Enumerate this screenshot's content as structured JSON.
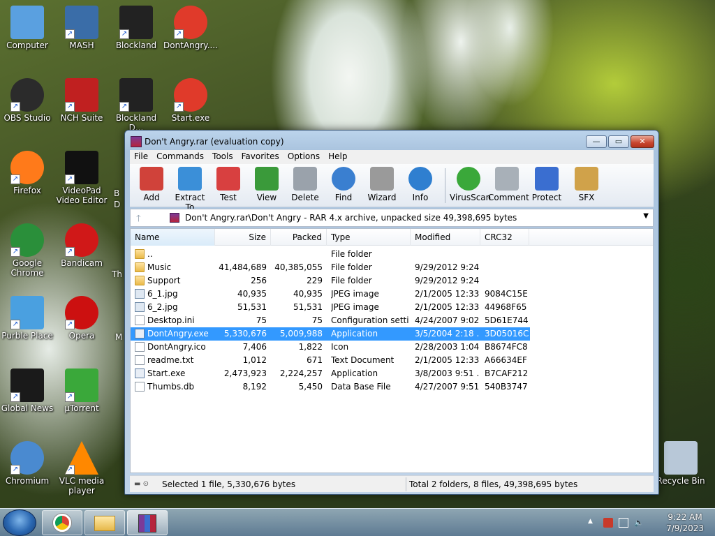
{
  "desktop": {
    "icons": [
      {
        "id": "computer",
        "label": "Computer",
        "color": "#5aa0e0"
      },
      {
        "id": "mash",
        "label": "MASH",
        "color": "#3a6da8"
      },
      {
        "id": "blockland",
        "label": "Blockland",
        "color": "#222222"
      },
      {
        "id": "dontangry",
        "label": "DontAngry....",
        "color": "#e03a2a"
      },
      {
        "id": "obs",
        "label": "OBS Studio",
        "color": "#2b2b2b"
      },
      {
        "id": "nch",
        "label": "NCH Suite",
        "color": "#c02020"
      },
      {
        "id": "blockland-d",
        "label": "Blockland D...",
        "color": "#222222"
      },
      {
        "id": "start-exe",
        "label": "Start.exe",
        "color": "#e03a2a"
      },
      {
        "id": "firefox",
        "label": "Firefox",
        "color": "#ff7a1a"
      },
      {
        "id": "videopad",
        "label": "VideoPad Video Editor",
        "color": "#111111"
      },
      {
        "id": "chrome",
        "label": "Google Chrome",
        "color": "#2a8f3a"
      },
      {
        "id": "bandicam",
        "label": "Bandicam",
        "color": "#d01818"
      },
      {
        "id": "purble",
        "label": "Purble Place",
        "color": "#4aa0e0"
      },
      {
        "id": "opera",
        "label": "Opera",
        "color": "#cc1010"
      },
      {
        "id": "globalnews",
        "label": "Global News",
        "color": "#1a1a1a"
      },
      {
        "id": "utorrent",
        "label": "µTorrent",
        "color": "#3aa83a"
      },
      {
        "id": "chromium",
        "label": "Chromium",
        "color": "#4a8ad0"
      },
      {
        "id": "vlc",
        "label": "VLC media player",
        "color": "#ff8800"
      },
      {
        "id": "recycle",
        "label": "Recycle Bin",
        "color": "#b8c8d8"
      }
    ],
    "partial_labels": [
      "B",
      "D",
      "Th",
      "M"
    ]
  },
  "window": {
    "title": "Don't Angry.rar (evaluation copy)",
    "menu": [
      "File",
      "Commands",
      "Tools",
      "Favorites",
      "Options",
      "Help"
    ],
    "toolbar": [
      {
        "label": "Add",
        "color": "#d0423a"
      },
      {
        "label": "Extract To",
        "color": "#3b8fd8"
      },
      {
        "label": "Test",
        "color": "#d84040"
      },
      {
        "label": "View",
        "color": "#3a9a3a"
      },
      {
        "label": "Delete",
        "color": "#9aa2ab"
      },
      {
        "label": "Find",
        "color": "#3a7fd0"
      },
      {
        "label": "Wizard",
        "color": "#9a9a9a"
      },
      {
        "label": "Info",
        "color": "#2f7fd0"
      },
      {
        "label": "VirusScan",
        "color": "#3aa83a"
      },
      {
        "label": "Comment",
        "color": "#a8b0b8"
      },
      {
        "label": "Protect",
        "color": "#3a6ed0"
      },
      {
        "label": "SFX",
        "color": "#d0a24a"
      }
    ],
    "address": "Don't Angry.rar\\Don't Angry - RAR 4.x archive, unpacked size 49,398,695 bytes",
    "columns": [
      "Name",
      "Size",
      "Packed",
      "Type",
      "Modified",
      "CRC32"
    ],
    "files": [
      {
        "name": "..",
        "size": "",
        "packed": "",
        "type": "File folder",
        "modified": "",
        "crc": "",
        "icon": "folder"
      },
      {
        "name": "Music",
        "size": "41,484,689",
        "packed": "40,385,055",
        "type": "File folder",
        "modified": "9/29/2012 9:24 ...",
        "crc": "",
        "icon": "folder"
      },
      {
        "name": "Support",
        "size": "256",
        "packed": "229",
        "type": "File folder",
        "modified": "9/29/2012 9:24 ...",
        "crc": "",
        "icon": "folder"
      },
      {
        "name": "6_1.jpg",
        "size": "40,935",
        "packed": "40,935",
        "type": "JPEG image",
        "modified": "2/1/2005 12:33 ...",
        "crc": "9084C15E",
        "icon": "img"
      },
      {
        "name": "6_2.jpg",
        "size": "51,531",
        "packed": "51,531",
        "type": "JPEG image",
        "modified": "2/1/2005 12:33 ...",
        "crc": "44968F65",
        "icon": "img"
      },
      {
        "name": "Desktop.ini",
        "size": "75",
        "packed": "75",
        "type": "Configuration setti...",
        "modified": "4/24/2007 9:02 ...",
        "crc": "5D61E744",
        "icon": "doc"
      },
      {
        "name": "DontAngry.exe",
        "size": "5,330,676",
        "packed": "5,009,988",
        "type": "Application",
        "modified": "3/5/2004 2:18 ...",
        "crc": "3D05016C",
        "icon": "exe"
      },
      {
        "name": "DontAngry.ico",
        "size": "7,406",
        "packed": "1,822",
        "type": "Icon",
        "modified": "2/28/2003 1:04 ...",
        "crc": "B8674FC8",
        "icon": "doc"
      },
      {
        "name": "readme.txt",
        "size": "1,012",
        "packed": "671",
        "type": "Text Document",
        "modified": "2/1/2005 12:33 ...",
        "crc": "A66634EF",
        "icon": "doc"
      },
      {
        "name": "Start.exe",
        "size": "2,473,923",
        "packed": "2,224,257",
        "type": "Application",
        "modified": "3/8/2003 9:51 ...",
        "crc": "B7CAF212",
        "icon": "exe"
      },
      {
        "name": "Thumbs.db",
        "size": "8,192",
        "packed": "5,450",
        "type": "Data Base File",
        "modified": "4/27/2007 9:51 ...",
        "crc": "540B3747",
        "icon": "doc"
      }
    ],
    "selected_index": 6,
    "status_left": "Selected 1 file, 5,330,676 bytes",
    "status_right": "Total 2 folders, 8 files, 49,398,695 bytes"
  },
  "taskbar": {
    "time": "9:22 AM",
    "date": "7/9/2023",
    "apps": [
      "chrome",
      "explorer",
      "winrar"
    ]
  }
}
